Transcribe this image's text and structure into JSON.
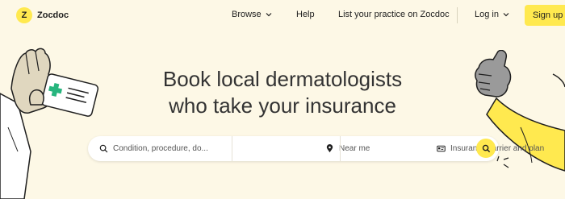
{
  "nav": {
    "logo_mark": "Z",
    "logo_text": "Zocdoc",
    "browse": "Browse",
    "help": "Help",
    "list_practice": "List your practice on Zocdoc",
    "login": "Log in",
    "signup": "Sign up"
  },
  "hero": {
    "line1": "Book local dermatologists",
    "line2": "who take your insurance"
  },
  "search": {
    "condition_placeholder": "Condition, procedure, do...",
    "location_placeholder": "Near me",
    "insurance_placeholder": "Insurance carrier and plan"
  },
  "colors": {
    "background": "#fdf8e6",
    "accent": "#ffe94f",
    "text": "#1f1f1f"
  },
  "icons": {
    "search": "search-icon",
    "location": "location-pin-icon",
    "insurance": "insurance-card-icon",
    "chevron": "chevron-down-icon"
  }
}
